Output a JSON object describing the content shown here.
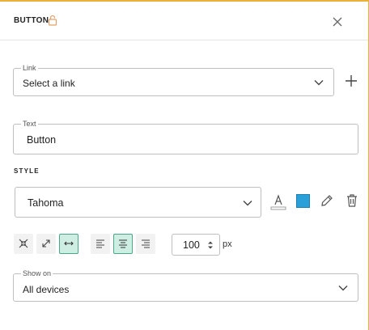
{
  "header": {
    "title": "BUTTON",
    "lock_icon": "lock-icon",
    "close_icon": "close-icon"
  },
  "link": {
    "legend": "Link",
    "value": "Select a link",
    "add_icon": "plus-icon"
  },
  "text": {
    "legend": "Text",
    "value": "Button"
  },
  "style": {
    "label": "STYLE",
    "font": "Tahoma",
    "font_color_icon": "font-color-icon",
    "background_color": "#2b9fd7",
    "edit_icon": "pencil-icon",
    "delete_icon": "trash-icon"
  },
  "toolbar": {
    "size_buttons": [
      {
        "name": "shrink",
        "icon": "collapse-icon",
        "active": false
      },
      {
        "name": "expand",
        "icon": "expand-icon",
        "active": false
      },
      {
        "name": "full-width",
        "icon": "horizontal-stretch-icon",
        "active": true
      }
    ],
    "align_buttons": [
      {
        "name": "left",
        "icon": "align-left-icon",
        "active": false
      },
      {
        "name": "center",
        "icon": "align-center-icon",
        "active": true
      },
      {
        "name": "right",
        "icon": "align-right-icon",
        "active": false
      }
    ],
    "width_value": "100",
    "width_unit": "px"
  },
  "show_on": {
    "legend": "Show on",
    "value": "All devices"
  },
  "colors": {
    "accent_border": "#e8b23a",
    "active_bg": "#cfeee3",
    "active_border": "#4aa889"
  }
}
